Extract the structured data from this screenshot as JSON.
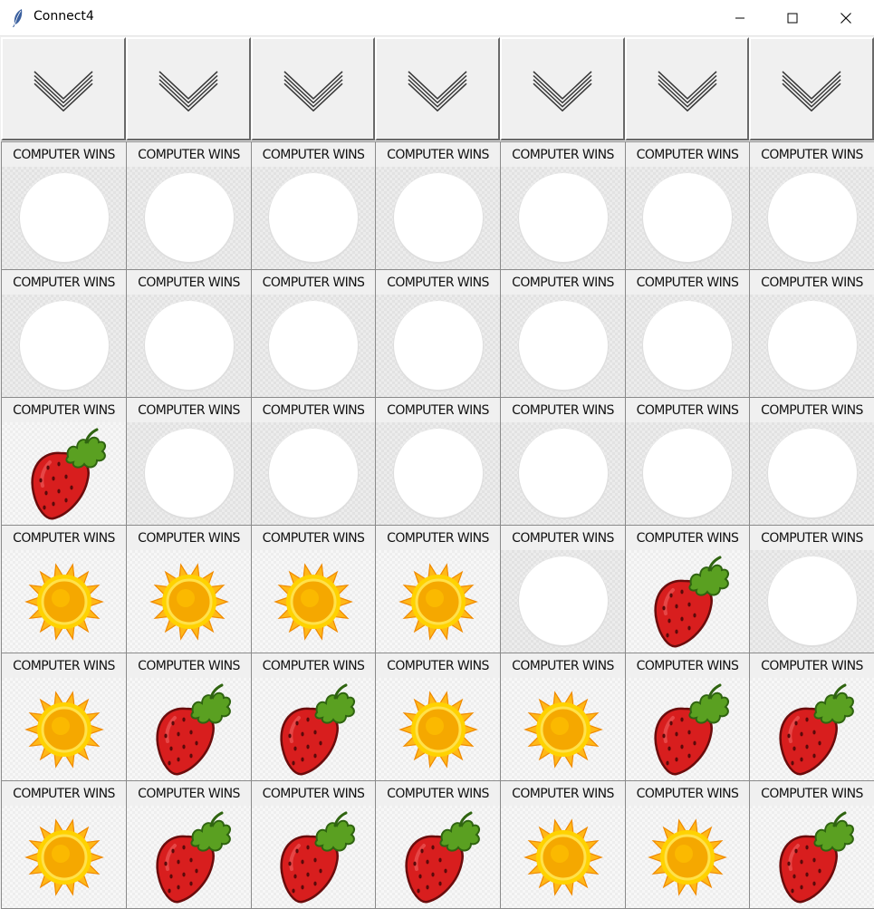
{
  "window": {
    "title": "Connect4",
    "icon": "feather-icon",
    "controls": [
      "minimize-icon",
      "maximize-icon",
      "close-icon"
    ]
  },
  "drop_buttons": {
    "count": 7,
    "icon": "chevron-down-icon"
  },
  "cell_label": "COMPUTER WINS",
  "tokens": {
    "empty": "empty-slot",
    "player": "sun-icon",
    "computer": "strawberry-icon"
  },
  "colors": {
    "sun": "#f5a800",
    "strawberry": "#d81e1e",
    "leaf": "#5aa021",
    "slot": "#ffffff"
  },
  "board": [
    [
      "empty",
      "empty",
      "empty",
      "empty",
      "empty",
      "empty",
      "empty"
    ],
    [
      "empty",
      "empty",
      "empty",
      "empty",
      "empty",
      "empty",
      "empty"
    ],
    [
      "strawberry",
      "empty",
      "empty",
      "empty",
      "empty",
      "empty",
      "empty"
    ],
    [
      "sun",
      "sun",
      "sun",
      "sun",
      "empty",
      "strawberry",
      "empty"
    ],
    [
      "sun",
      "strawberry",
      "strawberry",
      "sun",
      "sun",
      "strawberry",
      "strawberry"
    ],
    [
      "sun",
      "strawberry",
      "strawberry",
      "strawberry",
      "sun",
      "sun",
      "strawberry"
    ]
  ]
}
